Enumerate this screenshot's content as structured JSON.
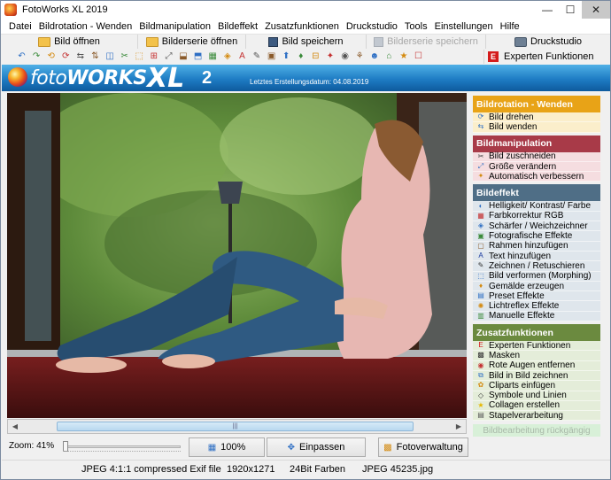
{
  "window": {
    "title": "FotoWorks XL 2019",
    "controls": {
      "minimize": "—",
      "maximize": "☐",
      "close": "✕"
    }
  },
  "menu": [
    "Datei",
    "Bildrotation - Wenden",
    "Bildmanipulation",
    "Bildeffekt",
    "Zusatzfunktionen",
    "Druckstudio",
    "Tools",
    "Einstellungen",
    "Hilfe"
  ],
  "toolbar1": {
    "open_image": "Bild öffnen",
    "open_series": "Bilderserie öffnen",
    "save_image": "Bild speichern",
    "save_series": "Bilderserie speichern",
    "print_studio": "Druckstudio"
  },
  "toolbar2": {
    "expert": "Experten Funktionen",
    "tools": [
      "↶",
      "↷",
      "⟲",
      "⟳",
      "⇆",
      "⇅",
      "◫",
      "✂",
      "⬚",
      "⊞",
      "⤢",
      "⬓",
      "⬒",
      "▦",
      "◈",
      "A",
      "✎",
      "▣",
      "⬆",
      "♦",
      "⊟",
      "✦",
      "◉",
      "⚘",
      "☻",
      "⌂",
      "★",
      "☐"
    ]
  },
  "banner": {
    "logo_prefix": "foto",
    "logo_bold": "WORKS",
    "logo_xl": "XL",
    "logo_num": "2",
    "last_created": "Letztes Erstellungsdatum: 04.08.2019"
  },
  "controls": {
    "zoom_label": "Zoom: 41%",
    "zoom_percent": 41,
    "btn_100": "100%",
    "btn_fit": "Einpassen",
    "btn_foto": "Fotoverwaltung",
    "scroll_grip": "|||"
  },
  "status": {
    "format": "JPEG 4:1:1 compressed Exif file",
    "resolution": "1920x1271",
    "colors": "24Bit Farben",
    "filename": "JPEG 45235.jpg"
  },
  "panel": {
    "sections": [
      {
        "title": "Bildrotation - Wenden",
        "head_color": "#e8a317",
        "item_bg": "#fbeecb",
        "items": [
          {
            "label": "Bild drehen",
            "icon": "rotate-icon",
            "glyph": "⟳",
            "color": "#2e6fc4"
          },
          {
            "label": "Bild wenden",
            "icon": "flip-icon",
            "glyph": "⇆",
            "color": "#2e6fc4"
          }
        ]
      },
      {
        "title": "Bildmanipulation",
        "head_color": "#a83a48",
        "item_bg": "#f5dde0",
        "items": [
          {
            "label": "Bild zuschneiden",
            "icon": "crop-icon",
            "glyph": "✂",
            "color": "#333333"
          },
          {
            "label": "Größe verändern",
            "icon": "resize-icon",
            "glyph": "⤢",
            "color": "#2e6fc4"
          },
          {
            "label": "Automatisch verbessern",
            "icon": "magic-icon",
            "glyph": "✦",
            "color": "#d48a10"
          }
        ]
      },
      {
        "title": "Bildeffekt",
        "head_color": "#4f6e86",
        "item_bg": "#dfe6ec",
        "items": [
          {
            "label": "Helligkeit/ Kontrast/ Farbe",
            "icon": "brightness-icon",
            "glyph": "◐",
            "color": "#2e6fc4"
          },
          {
            "label": "Farbkorrektur RGB",
            "icon": "rgb-icon",
            "glyph": "▦",
            "color": "#c43030"
          },
          {
            "label": "Schärfer / Weichzeichner",
            "icon": "sharpen-icon",
            "glyph": "◈",
            "color": "#2e6fc4"
          },
          {
            "label": "Fotografische Effekte",
            "icon": "photo-effect-icon",
            "glyph": "▣",
            "color": "#3a8a3a"
          },
          {
            "label": "Rahmen hinzufügen",
            "icon": "frame-icon",
            "glyph": "▢",
            "color": "#8a5a2a"
          },
          {
            "label": "Text hinzufügen",
            "icon": "text-icon",
            "glyph": "A",
            "color": "#1a3aa0"
          },
          {
            "label": "Zeichnen / Retuschieren",
            "icon": "pencil-icon",
            "glyph": "✎",
            "color": "#333333"
          },
          {
            "label": "Bild verformen (Morphing)",
            "icon": "morph-icon",
            "glyph": "⬚",
            "color": "#2e6fc4"
          },
          {
            "label": "Gemälde erzeugen",
            "icon": "paint-icon",
            "glyph": "♦",
            "color": "#d48a10"
          },
          {
            "label": "Preset Effekte",
            "icon": "preset-icon",
            "glyph": "▤",
            "color": "#2e6fc4"
          },
          {
            "label": "Lichtreflex Effekte",
            "icon": "lightflare-icon",
            "glyph": "✺",
            "color": "#d48a10"
          },
          {
            "label": "Manuelle Effekte",
            "icon": "manual-effect-icon",
            "glyph": "▥",
            "color": "#3a8a3a"
          }
        ]
      },
      {
        "title": "Zusatzfunktionen",
        "head_color": "#6b8a3f",
        "item_bg": "#e4edd9",
        "items": [
          {
            "label": "Experten Funktionen",
            "icon": "expert-icon",
            "glyph": "E",
            "color": "#d41c1c"
          },
          {
            "label": "Masken",
            "icon": "mask-icon",
            "glyph": "▩",
            "color": "#333333"
          },
          {
            "label": "Rote Augen entfernen",
            "icon": "eye-icon",
            "glyph": "◉",
            "color": "#c43030"
          },
          {
            "label": "Bild in Bild zeichnen",
            "icon": "picture-in-picture-icon",
            "glyph": "⧉",
            "color": "#2e6fc4"
          },
          {
            "label": "Cliparts einfügen",
            "icon": "clipart-icon",
            "glyph": "✿",
            "color": "#d48a10"
          },
          {
            "label": "Symbole und Linien",
            "icon": "symbols-icon",
            "glyph": "◇",
            "color": "#333333"
          },
          {
            "label": "Collagen erstellen",
            "icon": "collage-icon",
            "glyph": "★",
            "color": "#e6b800"
          },
          {
            "label": "Stapelverarbeitung",
            "icon": "batch-icon",
            "glyph": "▤",
            "color": "#555555"
          }
        ]
      }
    ],
    "undo": "Bildbearbeitung rückgängig"
  }
}
